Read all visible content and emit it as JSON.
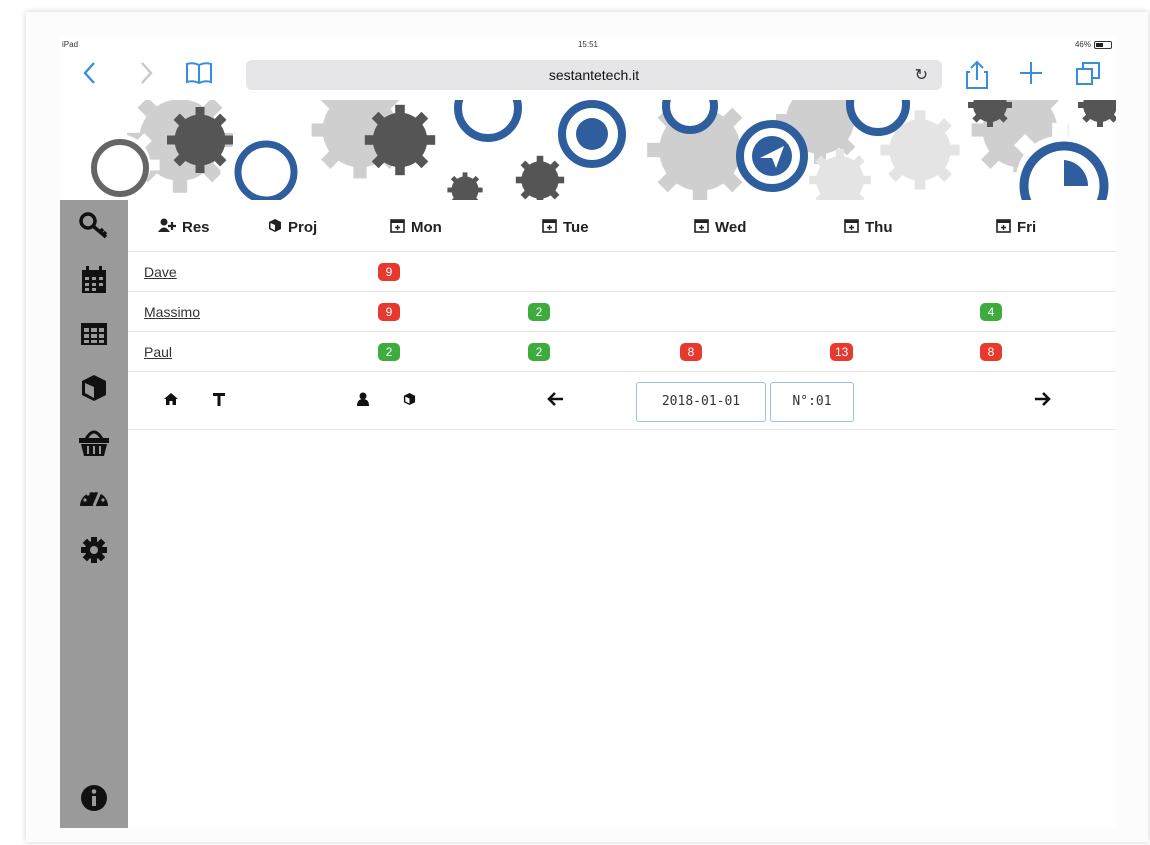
{
  "status_bar": {
    "device": "iPad",
    "time": "15:51",
    "battery": "46%"
  },
  "browser": {
    "url": "sestantetech.it"
  },
  "header": {
    "res_label": "Res",
    "proj_label": "Proj",
    "days": [
      "Mon",
      "Tue",
      "Wed",
      "Thu",
      "Fri"
    ]
  },
  "rows": [
    {
      "name": "Dave",
      "cells": {
        "Mon": "9"
      }
    },
    {
      "name": "Massimo",
      "cells": {
        "Mon": "9",
        "Tue": "2",
        "Fri": "4"
      }
    },
    {
      "name": "Paul",
      "cells": {
        "Mon": "2",
        "Tue": "2",
        "Wed": "8",
        "Thu": "13",
        "Fri": "8"
      }
    }
  ],
  "row_badges": {
    "dave_mon": "9",
    "massimo_mon": "9",
    "massimo_tue": "2",
    "massimo_fri": "4",
    "paul_mon": "2",
    "paul_tue": "2",
    "paul_wed": "8",
    "paul_thu": "13",
    "paul_fri": "8"
  },
  "controls": {
    "date": "2018-01-01",
    "week": "N°:01"
  },
  "colors": {
    "accent": "#3a8dde",
    "badge_red": "#e8392f",
    "badge_green": "#3eab3e",
    "sidebar": "#9a9a9a",
    "gear_blue": "#2f5e9e"
  },
  "icons": {
    "sidebar": [
      "key-icon",
      "calendar-icon",
      "table-icon",
      "cube-icon",
      "basket-icon",
      "dashboard-icon",
      "gear-icon",
      "info-icon"
    ],
    "toolbar": [
      "back-icon",
      "forward-icon",
      "bookmarks-icon",
      "reload-icon",
      "share-icon",
      "add-tab-icon",
      "tabs-icon"
    ],
    "controls": [
      "home-icon",
      "filter-icon",
      "user-icon",
      "cube-icon",
      "arrow-left-icon",
      "arrow-right-icon"
    ]
  }
}
